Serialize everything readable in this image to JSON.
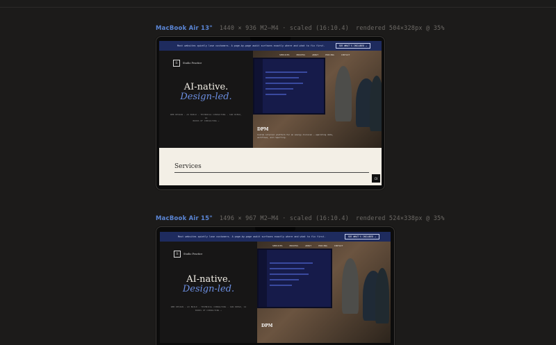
{
  "previews": [
    {
      "device_name": "MacBook Air 13\"",
      "specs": "1440 × 936  M2–M4 · scaled (16:10.4)",
      "rendered": "rendered 504×328px @ 35%"
    },
    {
      "device_name": "MacBook Air 15\"",
      "specs": "1496 × 967  M2–M4 · scaled (16:10.4)",
      "rendered": "rendered 524×338px @ 35%"
    }
  ],
  "site": {
    "logo_mark": "S",
    "logo_text": "Studio Practice",
    "banner_text": "Most websites quietly lose customers. A page-by-page audit surfaces exactly where and what to fix first.",
    "banner_cta": "SEE WHAT'S INCLUDED →",
    "nav": [
      "SERVICES",
      "PROCESS",
      "ABOUT",
      "PRICING",
      "CONTACT"
    ],
    "headline_1": "AI-native.",
    "headline_2": "Design-led.",
    "tagline": "WEB DESIGN · AI BUILD · TECHNICAL CONSULTING · SAN DIEGO, CA",
    "tagline_2": "BOOKS OF CONSULTING →",
    "photo_caption_title": "DPM",
    "photo_caption_sub": "Custom internal platform for an energy division — operating data, workflows, and reporting.",
    "section_title": "Services",
    "badge": "CX"
  },
  "colors": {
    "background": "#1c1b1a",
    "accent_blue": "#5b86d6",
    "banner": "#1e2b5e",
    "headline_italic": "#6c8fe2",
    "services_bg": "#f3efe6"
  }
}
